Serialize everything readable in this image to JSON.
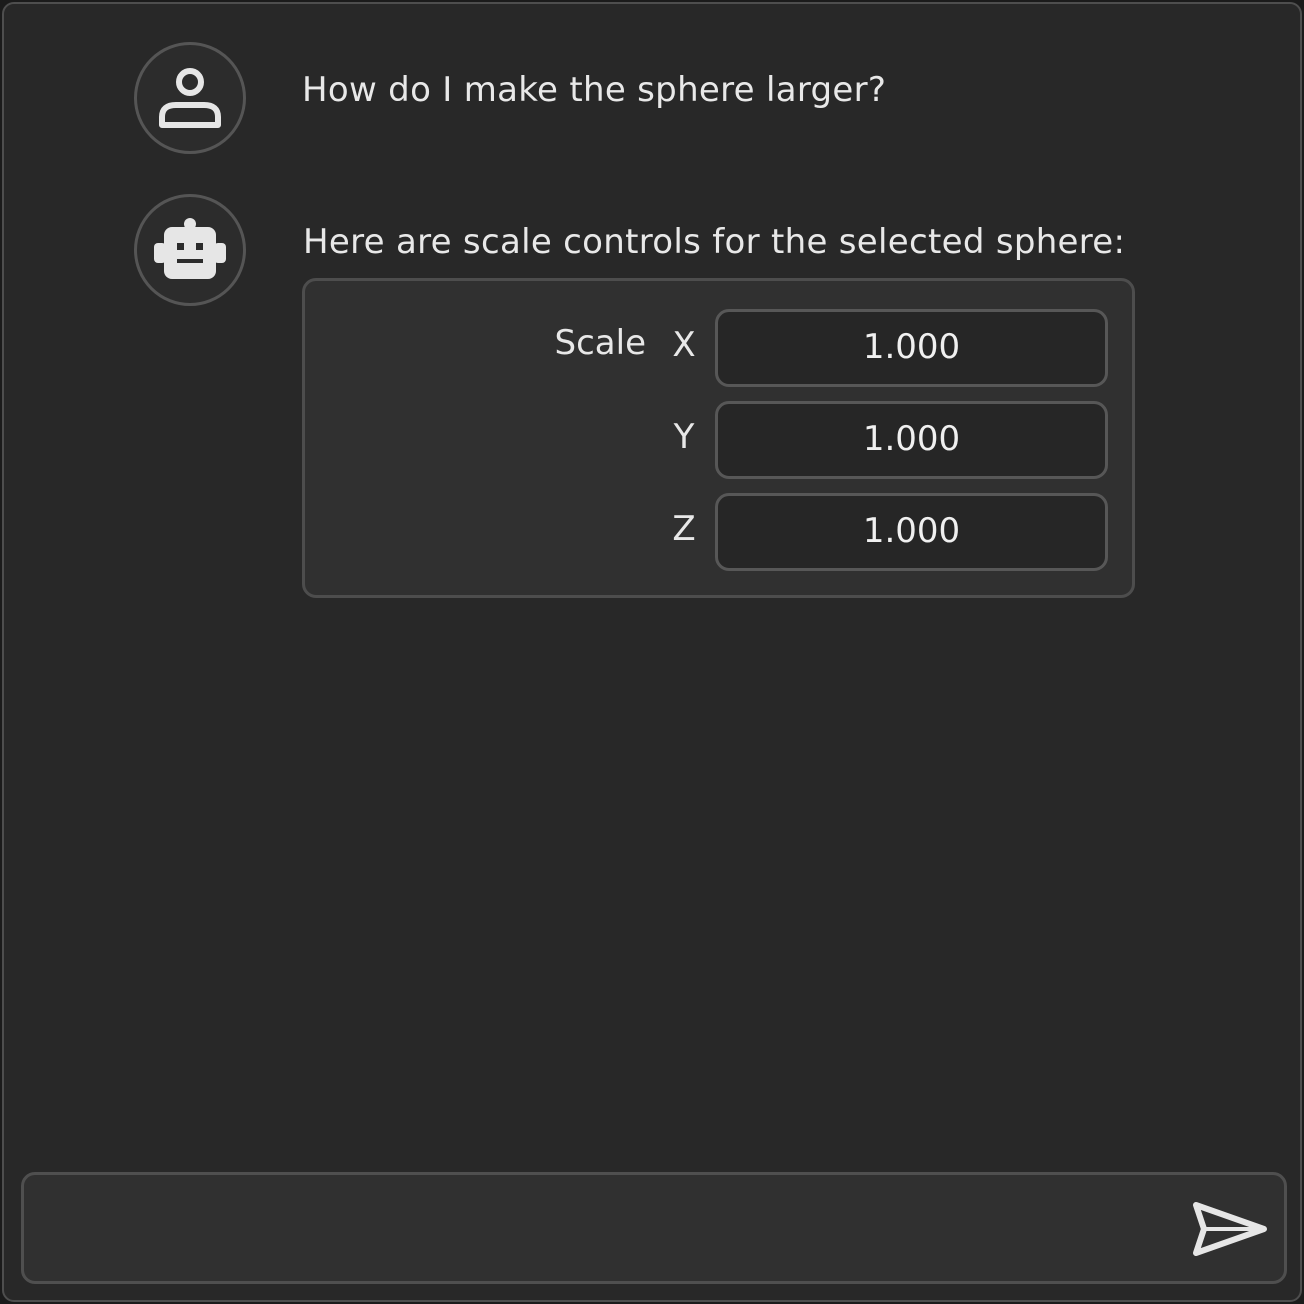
{
  "conversation": {
    "messages": [
      {
        "role": "user",
        "avatar_icon": "user-icon",
        "text": "How do I make the sphere larger?"
      },
      {
        "role": "assistant",
        "avatar_icon": "robot-icon",
        "text": "Here are scale controls for the selected sphere:"
      }
    ]
  },
  "scale_controls": {
    "label": "Scale",
    "axes": [
      {
        "axis": "X",
        "value": "1.000"
      },
      {
        "axis": "Y",
        "value": "1.000"
      },
      {
        "axis": "Z",
        "value": "1.000"
      }
    ]
  },
  "composer": {
    "placeholder": "",
    "value": "",
    "send_icon": "send-icon"
  },
  "colors": {
    "background": "#282828",
    "panel": "#303030",
    "border": "#4e4e4e",
    "text": "#e8e8e8"
  }
}
